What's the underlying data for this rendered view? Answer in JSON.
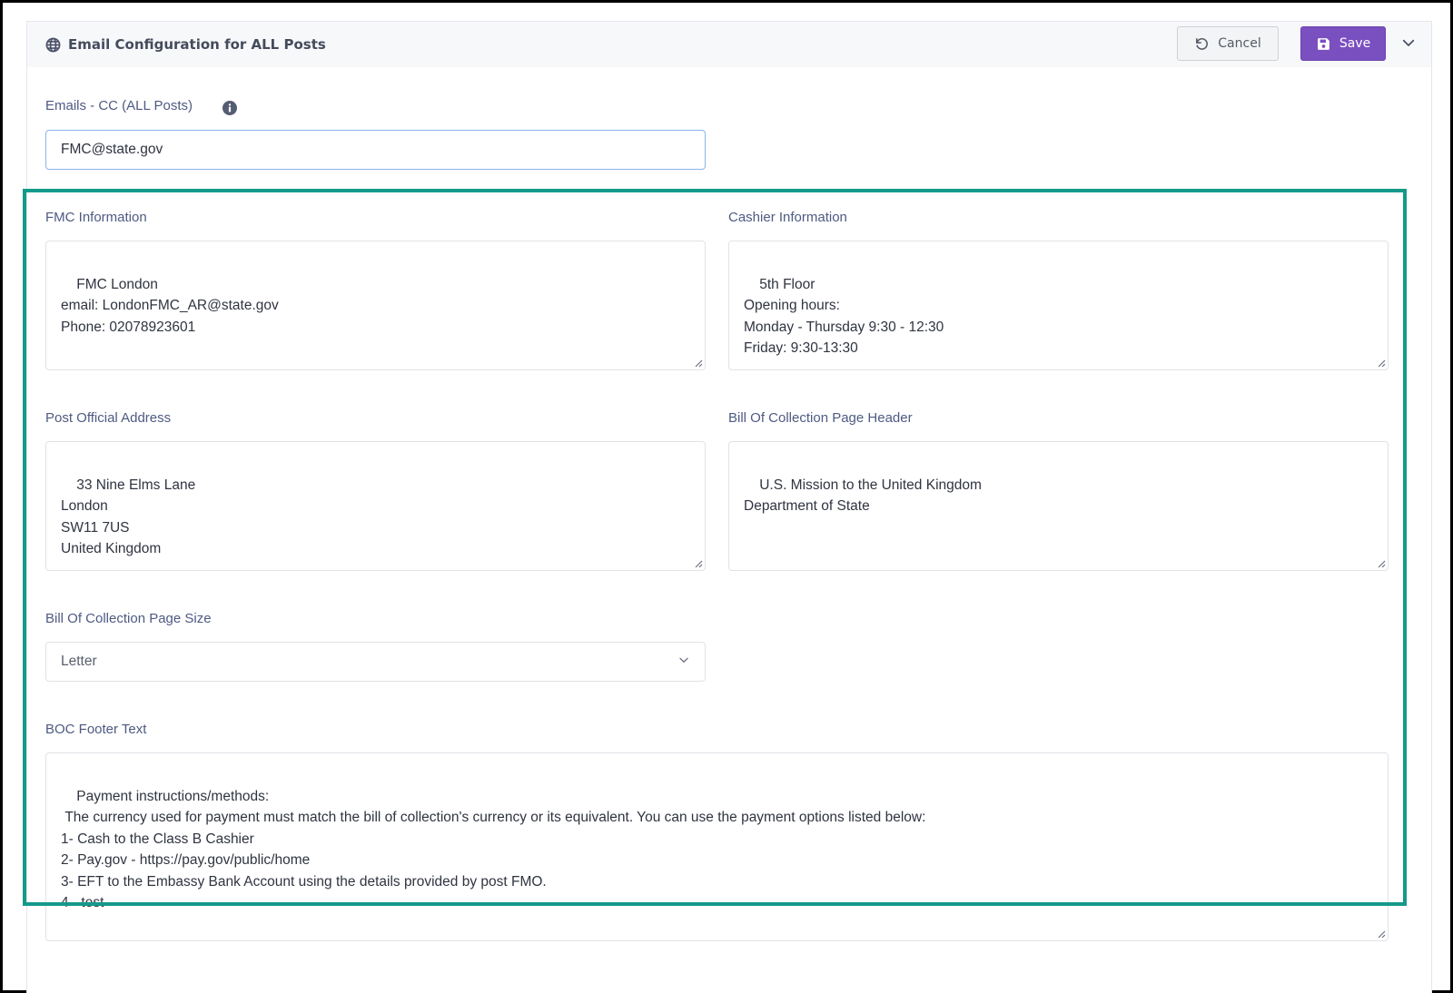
{
  "header": {
    "title": "Email Configuration for ALL Posts",
    "icon": "globe-icon",
    "cancel_label": "Cancel",
    "save_label": "Save",
    "accent_color": "#7a4fbf"
  },
  "emails_cc": {
    "label": "Emails - CC (ALL Posts)",
    "value": "FMC@state.gov"
  },
  "fmc_information": {
    "label": "FMC Information",
    "value": "FMC London\nemail: LondonFMC_AR@state.gov\nPhone: 02078923601"
  },
  "cashier_information": {
    "label": "Cashier Information",
    "value": "5th Floor\nOpening hours:\nMonday - Thursday 9:30 - 12:30\nFriday: 9:30-13:30"
  },
  "post_official_address": {
    "label": "Post Official Address",
    "value": "33 Nine Elms Lane\nLondon\nSW11 7US\nUnited Kingdom"
  },
  "boc_page_header": {
    "label": "Bill Of Collection Page Header",
    "value": "U.S. Mission to the United Kingdom\nDepartment of State"
  },
  "boc_page_size": {
    "label": "Bill Of Collection Page Size",
    "selected": "Letter"
  },
  "boc_footer": {
    "label": "BOC Footer Text",
    "value": "Payment instructions/methods:\n The currency used for payment must match the bill of collection's currency or its equivalent. You can use the payment options listed below:\n1- Cash to the Class B Cashier\n2- Pay.gov - https://pay.gov/public/home\n3- EFT to the Embassy Bank Account using the details provided by post FMO.\n4 - test"
  },
  "highlight_color": "#14998a"
}
